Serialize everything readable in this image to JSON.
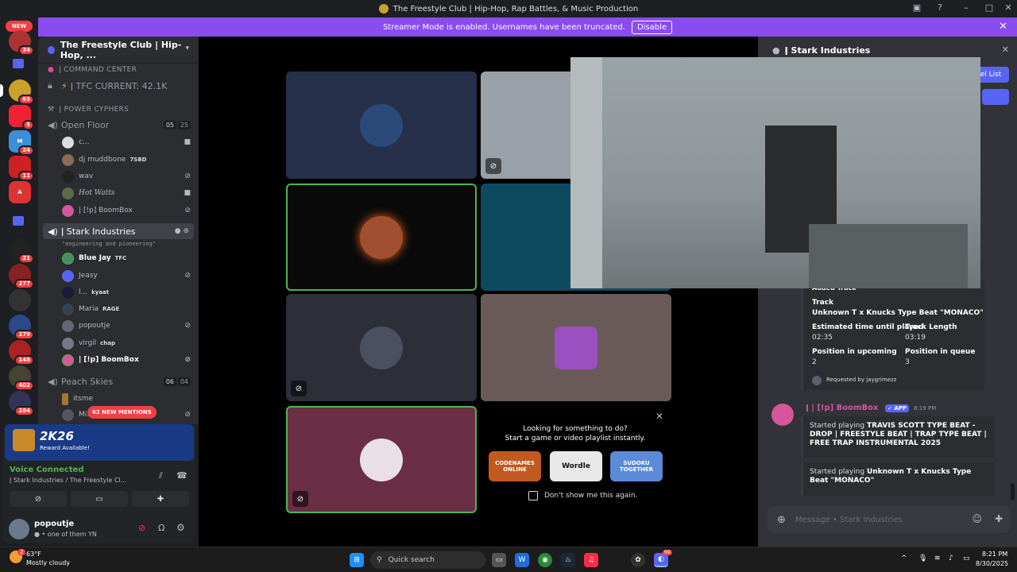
{
  "window": {
    "title": "The Freestyle Club | Hip-Hop, Rap Battles, & Music Production"
  },
  "banner": {
    "text": "Streamer Mode is enabled. Usernames have been truncated.",
    "button": "Disable"
  },
  "rail": {
    "new_label": "NEW",
    "badges": [
      "34",
      "65",
      "5",
      "24",
      "11",
      "21",
      "277",
      "279",
      "148",
      "402",
      "284"
    ]
  },
  "sidebar": {
    "server_name": "The Freestyle Club | Hip-Hop, ...",
    "cat1": "COMMAND CENTER",
    "tfc_channel": "TFC CURRENT: 42.1K",
    "cat2": "POWER CYPHERS",
    "open_floor": "Open Floor",
    "open_floor_count": "05",
    "open_floor_limit": "25",
    "of_users": [
      {
        "name": "c...",
        "tag": ""
      },
      {
        "name": "dj muddbone",
        "tag": "7SBD"
      },
      {
        "name": "wav",
        "tag": ""
      },
      {
        "name": "Hot Watts",
        "tag": ""
      },
      {
        "name": "| [!p] BoomBox",
        "tag": ""
      }
    ],
    "stark": "Stark Industries",
    "stark_status": "\"engineering and pioneering\"",
    "st_users": [
      {
        "name": "Blue Jay",
        "tag": "TFC"
      },
      {
        "name": "Jeasy",
        "tag": ""
      },
      {
        "name": "l...",
        "tag": "kyaat"
      },
      {
        "name": "Maria",
        "tag": "RAGE"
      },
      {
        "name": "popoutje",
        "tag": ""
      },
      {
        "name": "virgil",
        "tag": "chap"
      },
      {
        "name": "| [!p] BoomBox",
        "tag": ""
      }
    ],
    "peach": "Peach Skies",
    "peach_count": "06",
    "peach_limit": "04",
    "pk_users": [
      {
        "name": "itsme"
      },
      {
        "name": "Mi..."
      }
    ],
    "mentions": "62 NEW MENTIONS"
  },
  "promo": {
    "game": "2K26",
    "sub": "Reward Available!"
  },
  "voice": {
    "status": "Voice Connected",
    "location": "Stark Industries / The Freestyle Cl..."
  },
  "me": {
    "name": "popoutje",
    "status": "one of them YN"
  },
  "activity": {
    "line1": "Looking for something to do?",
    "line2": "Start a game or video playlist instantly.",
    "games": [
      "CODENAMES ONLINE",
      "Wordle",
      "SUDOKU TOGETHER"
    ],
    "checkbox": "Don't show me this again."
  },
  "right": {
    "channel": "Stark Industries",
    "partial_btn": "nel List",
    "added_track": "Added Track",
    "track_label": "Track",
    "track_value": "Unknown T x Knucks Type Beat \"MONACO\"",
    "eta_label": "Estimated time until played",
    "eta_value": "02:35",
    "len_label": "Track Length",
    "len_value": "03:19",
    "pos_up_label": "Position in upcoming",
    "pos_up_value": "2",
    "pos_q_label": "Position in queue",
    "pos_q_value": "3",
    "requested": "Requested by jaygrimezz",
    "bot_name": "| [!p] BoomBox",
    "app_badge": "APP",
    "time": "8:19 PM",
    "msg1_prefix": "Started playing ",
    "msg1_bold": "TRAVIS SCOTT TYPE BEAT - DROP | FREESTYLE BEAT | TRAP TYPE BEAT | FREE TRAP INSTRUMENTAL 2025",
    "msg2_prefix": "Started playing ",
    "msg2_bold": "Unknown T x Knucks Type Beat \"MONACO\"",
    "placeholder": "Message • Stark Industries"
  },
  "taskbar": {
    "temp": "63°F",
    "weather": "Mostly cloudy",
    "weather_badge": "2",
    "search": "Quick search",
    "time": "8:21 PM",
    "date": "8/30/2025",
    "discord_badge": "99"
  },
  "colors": {
    "accent": "#5865f2",
    "banner": "#8a4bf0",
    "speaking": "#4bb84b"
  }
}
